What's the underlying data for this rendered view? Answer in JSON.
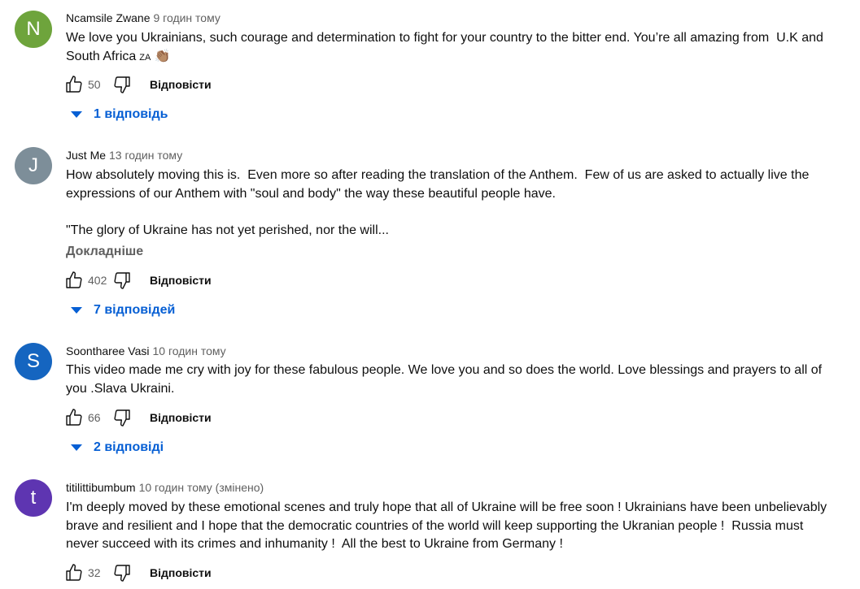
{
  "comments": [
    {
      "initial": "N",
      "avatar_color": "#6ea43c",
      "author": "Ncamsile Zwane",
      "time": "9 годин тому",
      "text": "We love you Ukrainians, such courage and determination to fight for your country to the bitter end. You’re all amazing from  U.K and South Africa",
      "flag_text": "ZA",
      "emoji": "👏🏽",
      "likes": "50",
      "reply_label": "Відповісти",
      "replies_label": "1 відповідь"
    },
    {
      "initial": "J",
      "avatar_color": "#7d8e99",
      "author": "Just Me",
      "time": "13 годин тому",
      "text": "How absolutely moving this is.  Even more so after reading the translation of the Anthem.  Few of us are asked to actually live the expressions of our Anthem with \"soul and body\" the way these beautiful people have.\n\n\"The glory of Ukraine has not yet perished, nor the will...",
      "more_label": "Докладніше",
      "likes": "402",
      "reply_label": "Відповісти",
      "replies_label": "7 відповідей"
    },
    {
      "initial": "S",
      "avatar_color": "#1565c0",
      "author": "Soontharee Vasi",
      "time": "10 годин тому",
      "text": "This video made me cry with joy for these fabulous people. We love you and so does the world. Love blessings and prayers to all of you .Slava Ukraini.",
      "likes": "66",
      "reply_label": "Відповісти",
      "replies_label": "2 відповіді"
    },
    {
      "initial": "t",
      "avatar_color": "#5e35b1",
      "author": "titilittibumbum",
      "time": "10 годин тому (змінено)",
      "text": "I'm deeply moved by these emotional scenes and truly hope that all of Ukraine will be free soon ! Ukrainians have been unbelievably brave and resilient and I hope that the democratic countries of the world will keep supporting the Ukranian people !  Russia must never succeed with its crimes and inhumanity !  All the best to Ukraine from Germany !",
      "likes": "32",
      "reply_label": "Відповісти"
    }
  ],
  "icons": {
    "like": "thumb-up-icon",
    "dislike": "thumb-down-icon",
    "expand": "triangle-down-icon"
  }
}
